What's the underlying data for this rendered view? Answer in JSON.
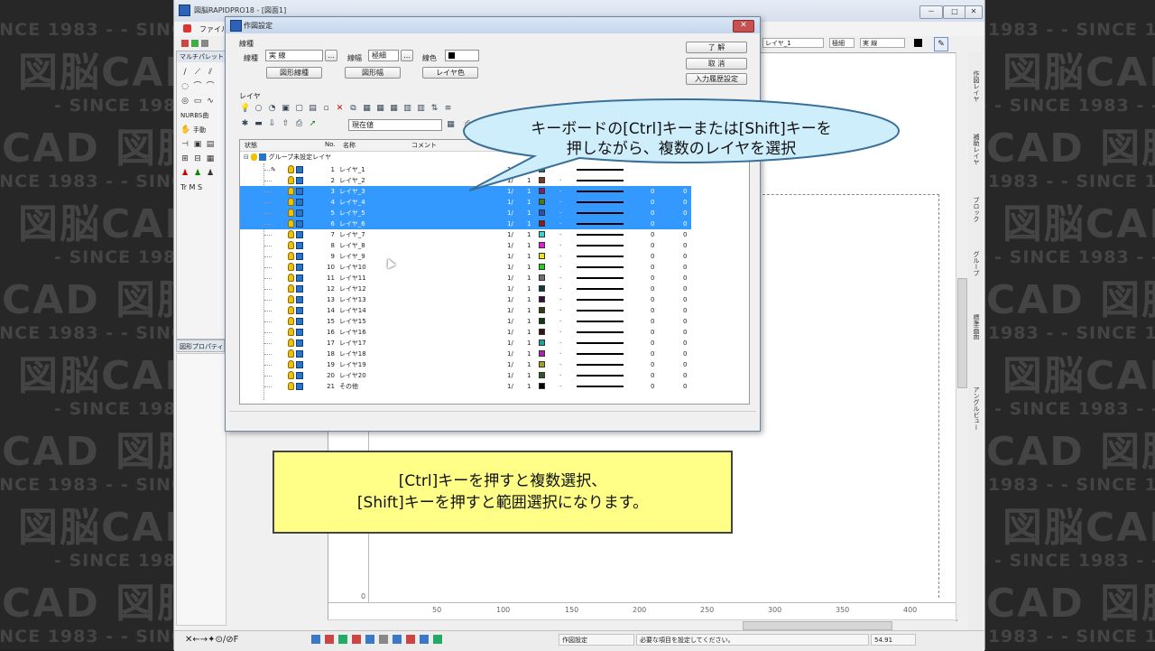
{
  "watermark": {
    "brand": "図脳CAD",
    "tagline": "- SINCE 1983 -"
  },
  "app": {
    "title": "図脳RAPIDPRO18 - [図面1]",
    "menu_first": "ファイル",
    "window_buttons": [
      "－",
      "□",
      "✕"
    ]
  },
  "palette": {
    "title": "マルチパレット",
    "nurbs_label": "NURBS曲",
    "hand_label": "手動",
    "text_label": "Tr M S"
  },
  "figure_property": {
    "title": "図形プロパティ"
  },
  "top_right_toolbar": {
    "layer": "レイヤ_1",
    "width": "極細",
    "linetype": "実 線"
  },
  "canvas": {
    "x_ticks": [
      "0",
      "50",
      "100",
      "150",
      "200",
      "250",
      "300",
      "350",
      "400"
    ]
  },
  "right_panel_tabs": [
    "作図レイヤ",
    "補助レイヤ",
    "ブロック",
    "グループ",
    "標準画面",
    "アングルビュー"
  ],
  "status": {
    "command": "作図設定",
    "message": "必要な項目を設定してください。",
    "coord": "54.91"
  },
  "dialog": {
    "title": "作図設定",
    "close": "✕",
    "linetype_group": "線種",
    "linetype_label": "線種",
    "linetype_value": "実 線",
    "linewidth_label": "線幅",
    "linewidth_value": "極細",
    "linecolor_label": "線色",
    "btn_figure_linetype": "図形線種",
    "btn_figure_width": "図形幅",
    "btn_layer_color": "レイヤ色",
    "btn_ok": "了 解",
    "btn_cancel": "取 消",
    "btn_history": "入力履歴設定",
    "layer_group": "レイヤ",
    "current_value": "現在値",
    "col_state": "状態",
    "col_no": "No.",
    "col_name": "名称",
    "col_comment": "コメント",
    "group_label": "グループ未設定レイヤ",
    "layers": [
      {
        "no": "1",
        "name": "レイヤ_1",
        "scale": "1/",
        "v1": "1",
        "color": "#1f6f5a",
        "dot": "",
        "line": true,
        "a": "",
        "b": "",
        "selected": false,
        "current": true
      },
      {
        "no": "2",
        "name": "レイヤ_2",
        "scale": "1/",
        "v1": "1",
        "color": "#7a3b1d",
        "dot": "·",
        "line": true,
        "a": "",
        "b": "",
        "selected": false,
        "current": false
      },
      {
        "no": "3",
        "name": "レイヤ_3",
        "scale": "1/",
        "v1": "1",
        "color": "#7a1f6a",
        "dot": "·",
        "line": true,
        "a": "0",
        "b": "0",
        "selected": true,
        "current": false
      },
      {
        "no": "4",
        "name": "レイヤ_4",
        "scale": "1/",
        "v1": "1",
        "color": "#4a7a10",
        "dot": "·",
        "line": true,
        "a": "0",
        "b": "0",
        "selected": true,
        "current": false
      },
      {
        "no": "5",
        "name": "レイヤ_5",
        "scale": "1/",
        "v1": "1",
        "color": "#2a4fb0",
        "dot": "·",
        "line": true,
        "a": "0",
        "b": "0",
        "selected": true,
        "current": false
      },
      {
        "no": "6",
        "name": "レイヤ_6",
        "scale": "1/",
        "v1": "1",
        "color": "#8a1a1a",
        "dot": "·",
        "line": true,
        "a": "0",
        "b": "0",
        "selected": true,
        "current": false
      },
      {
        "no": "7",
        "name": "レイヤ_7",
        "scale": "1/",
        "v1": "1",
        "color": "#33d6d6",
        "dot": "·",
        "line": true,
        "a": "0",
        "b": "0",
        "selected": false,
        "current": false
      },
      {
        "no": "8",
        "name": "レイヤ_8",
        "scale": "1/",
        "v1": "1",
        "color": "#e020d0",
        "dot": "·",
        "line": true,
        "a": "0",
        "b": "0",
        "selected": false,
        "current": false
      },
      {
        "no": "9",
        "name": "レイヤ_9",
        "scale": "1/",
        "v1": "1",
        "color": "#e6e61a",
        "dot": "·",
        "line": true,
        "a": "0",
        "b": "0",
        "selected": false,
        "current": false
      },
      {
        "no": "10",
        "name": "レイヤ10",
        "scale": "1/",
        "v1": "1",
        "color": "#20d020",
        "dot": "·",
        "line": true,
        "a": "0",
        "b": "0",
        "selected": false,
        "current": false
      },
      {
        "no": "11",
        "name": "レイヤ11",
        "scale": "1/",
        "v1": "1",
        "color": "#707070",
        "dot": "·",
        "line": true,
        "a": "0",
        "b": "0",
        "selected": false,
        "current": false
      },
      {
        "no": "12",
        "name": "レイヤ12",
        "scale": "1/",
        "v1": "1",
        "color": "#0e3a3a",
        "dot": "·",
        "line": true,
        "a": "0",
        "b": "0",
        "selected": false,
        "current": false
      },
      {
        "no": "13",
        "name": "レイヤ13",
        "scale": "1/",
        "v1": "1",
        "color": "#3a0a40",
        "dot": "·",
        "line": true,
        "a": "0",
        "b": "0",
        "selected": false,
        "current": false
      },
      {
        "no": "14",
        "name": "レイヤ14",
        "scale": "1/",
        "v1": "1",
        "color": "#3a3a10",
        "dot": "·",
        "line": true,
        "a": "0",
        "b": "0",
        "selected": false,
        "current": false
      },
      {
        "no": "15",
        "name": "レイヤ15",
        "scale": "1/",
        "v1": "1",
        "color": "#103a10",
        "dot": "·",
        "line": true,
        "a": "0",
        "b": "0",
        "selected": false,
        "current": false
      },
      {
        "no": "16",
        "name": "レイヤ16",
        "scale": "1/",
        "v1": "1",
        "color": "#3a1010",
        "dot": "·",
        "line": true,
        "a": "0",
        "b": "0",
        "selected": false,
        "current": false
      },
      {
        "no": "17",
        "name": "レイヤ17",
        "scale": "1/",
        "v1": "1",
        "color": "#20a0a0",
        "dot": "·",
        "line": true,
        "a": "0",
        "b": "0",
        "selected": false,
        "current": false
      },
      {
        "no": "18",
        "name": "レイヤ18",
        "scale": "1/",
        "v1": "1",
        "color": "#b020b0",
        "dot": "·",
        "line": true,
        "a": "0",
        "b": "0",
        "selected": false,
        "current": false
      },
      {
        "no": "19",
        "name": "レイヤ19",
        "scale": "1/",
        "v1": "1",
        "color": "#a0a020",
        "dot": "·",
        "line": true,
        "a": "0",
        "b": "0",
        "selected": false,
        "current": false
      },
      {
        "no": "20",
        "name": "レイヤ20",
        "scale": "1/",
        "v1": "1",
        "color": "#2a5a2a",
        "dot": "·",
        "line": true,
        "a": "0",
        "b": "0",
        "selected": false,
        "current": false
      },
      {
        "no": "21",
        "name": "その他",
        "scale": "1/",
        "v1": "1",
        "color": "#000000",
        "dot": "·",
        "line": true,
        "a": "0",
        "b": "0",
        "selected": false,
        "current": false
      }
    ]
  },
  "callout": {
    "line1": "キーボードの[Ctrl]キーまたは[Shift]キーを",
    "line2": "押しながら、複数のレイヤを選択"
  },
  "note": {
    "line1": "[Ctrl]キーを押すと複数選択、",
    "line2": "[Shift]キーを押すと範囲選択になります。"
  }
}
